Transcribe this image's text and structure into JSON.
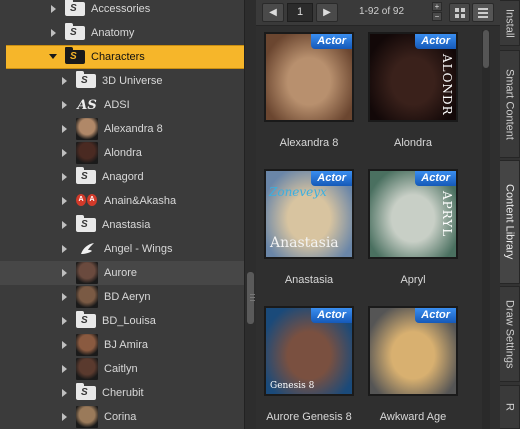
{
  "tree": {
    "items": [
      {
        "label": "Accessories",
        "icon": "folder-icon",
        "arrow": "right",
        "indent": 1
      },
      {
        "label": "Anatomy",
        "icon": "folder-icon",
        "arrow": "right",
        "indent": 1
      },
      {
        "label": "Characters",
        "icon": "folder-icon",
        "arrow": "down",
        "indent": 1,
        "selected": true
      },
      {
        "label": "3D Universe",
        "icon": "folder-icon",
        "arrow": "right",
        "indent": 2
      },
      {
        "label": "ADSI",
        "icon": "as-logo-icon",
        "logo_text": "AS",
        "arrow": "right",
        "indent": 2
      },
      {
        "label": "Alexandra 8",
        "icon": "portrait-thumbnail",
        "arrow": "right",
        "indent": 2,
        "color": "#b08868"
      },
      {
        "label": "Alondra",
        "icon": "portrait-thumbnail",
        "arrow": "right",
        "indent": 2,
        "color": "#4a2a22"
      },
      {
        "label": "Anagord",
        "icon": "folder-icon",
        "arrow": "right",
        "indent": 2
      },
      {
        "label": "Anain&Akasha",
        "icon": "aa-logo-icon",
        "logo_text": "AA",
        "arrow": "right",
        "indent": 2
      },
      {
        "label": "Anastasia",
        "icon": "folder-icon",
        "arrow": "right",
        "indent": 2
      },
      {
        "label": "Angel - Wings",
        "icon": "wing-icon",
        "arrow": "right",
        "indent": 2
      },
      {
        "label": "Aurore",
        "icon": "portrait-thumbnail",
        "arrow": "right",
        "indent": 2,
        "color": "#6a4a3e",
        "hover": true
      },
      {
        "label": "BD Aeryn",
        "icon": "portrait-thumbnail",
        "arrow": "right",
        "indent": 2,
        "color": "#7a5a44"
      },
      {
        "label": "BD_Louisa",
        "icon": "folder-icon",
        "arrow": "right",
        "indent": 2
      },
      {
        "label": "BJ Amira",
        "icon": "portrait-thumbnail",
        "arrow": "right",
        "indent": 2,
        "color": "#8a5a40"
      },
      {
        "label": "Caitlyn",
        "icon": "portrait-thumbnail",
        "arrow": "right",
        "indent": 2,
        "color": "#5a3a2e"
      },
      {
        "label": "Cherubit",
        "icon": "folder-icon",
        "arrow": "right",
        "indent": 2
      },
      {
        "label": "Corina",
        "icon": "portrait-thumbnail",
        "arrow": "right",
        "indent": 2,
        "color": "#9a7a5a"
      }
    ]
  },
  "toolbar": {
    "page": "1",
    "range": "1-92 of 92",
    "prev_icon": "arrow-left-icon",
    "next_icon": "arrow-right-icon",
    "grid_view_icon": "grid-view-icon",
    "list_view_icon": "list-view-icon"
  },
  "cards": [
    {
      "name": "Alexandra 8",
      "badge": "Actor",
      "bg": "#b8906e",
      "bg2": "#6b4630"
    },
    {
      "name": "Alondra",
      "badge": "Actor",
      "bg": "#3a211b",
      "bg2": "#120808",
      "vertical_text": "ALONDR"
    },
    {
      "name": "Anastasia",
      "badge": "Actor",
      "bg": "#d8c4a0",
      "bg2": "#6a86a8",
      "overlay_text": "Anastasia",
      "brand_text": "Zoneveyx"
    },
    {
      "name": "Apryl",
      "badge": "Actor",
      "bg": "#c8cfc6",
      "bg2": "#4a7060",
      "vertical_text": "APRYL"
    },
    {
      "name": "Aurore Genesis 8",
      "badge": "Actor",
      "bg": "#7a5040",
      "bg2": "#1a4a7a",
      "small_text": "Genesis 8"
    },
    {
      "name": "Awkward Age",
      "badge": "Actor",
      "bg": "#d8b070",
      "bg2": "#555555"
    }
  ],
  "side_tabs": [
    {
      "label": "Install"
    },
    {
      "label": "Smart Content"
    },
    {
      "label": "Content Library",
      "active": true
    },
    {
      "label": "Draw Settings"
    },
    {
      "label": "R"
    }
  ]
}
